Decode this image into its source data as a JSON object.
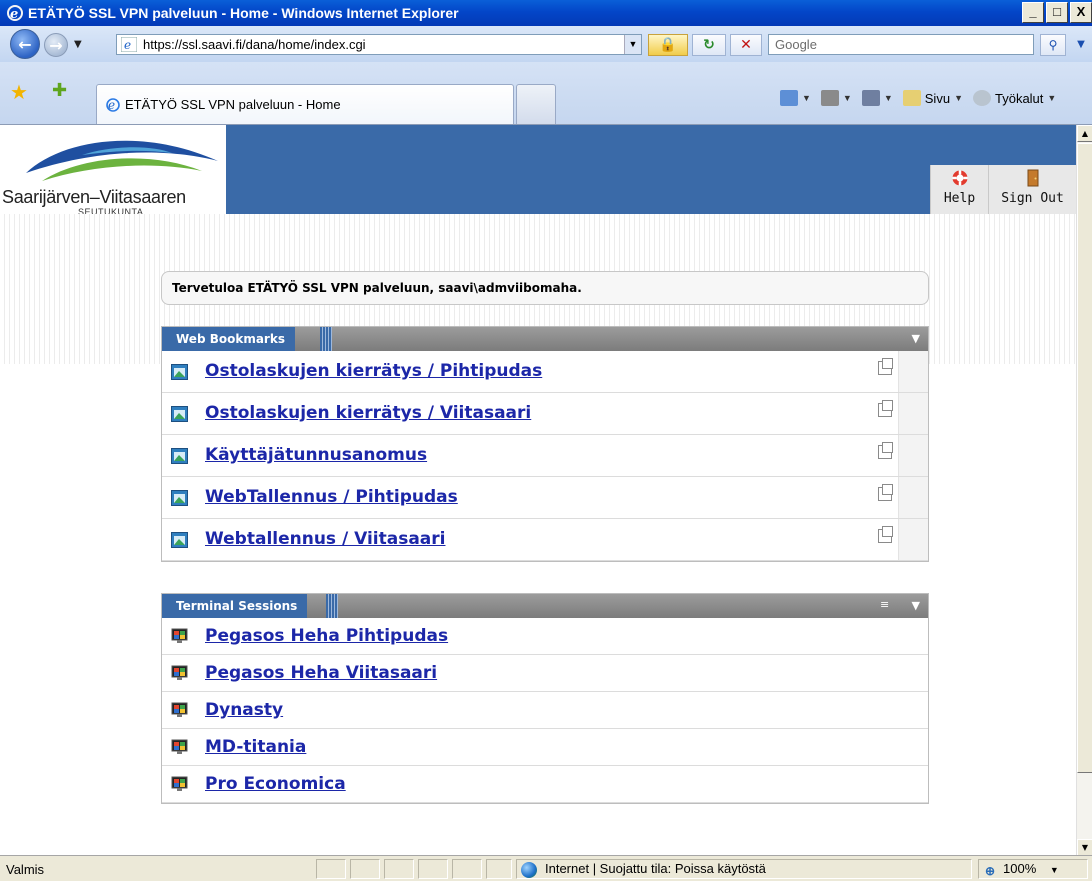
{
  "window": {
    "title": "ETÄTYÖ SSL VPN palveluun - Home - Windows Internet Explorer",
    "min": "_",
    "max": "□",
    "close": "X"
  },
  "address": {
    "url": "https://ssl.saavi.fi/dana/home/index.cgi",
    "search_placeholder": "Google"
  },
  "tabs": {
    "active_label": "ETÄTYÖ SSL VPN palveluun - Home"
  },
  "commands": {
    "page_label": "Sivu",
    "tools_label": "Työkalut"
  },
  "header": {
    "logo_name": "Saarijärven–Viitasaaren",
    "logo_sub": "SEUTUKUNTA",
    "help_label": "Help",
    "signout_label": "Sign Out"
  },
  "welcome": "Tervetuloa ETÄTYÖ SSL VPN palveluun, saavi\\admviibomaha.",
  "web_bookmarks": {
    "title": "Web Bookmarks",
    "items": [
      {
        "label": "Ostolaskujen kierrätys / Pihtipudas"
      },
      {
        "label": "Ostolaskujen kierrätys / Viitasaari"
      },
      {
        "label": "Käyttäjätunnusanomus"
      },
      {
        "label": "WebTallennus / Pihtipudas"
      },
      {
        "label": "Webtallennus / Viitasaari"
      }
    ]
  },
  "terminal_sessions": {
    "title": "Terminal Sessions",
    "items": [
      {
        "label": "Pegasos Heha Pihtipudas"
      },
      {
        "label": "Pegasos Heha Viitasaari"
      },
      {
        "label": "Dynasty"
      },
      {
        "label": "MD-titania"
      },
      {
        "label": "Pro Economica"
      }
    ]
  },
  "status": {
    "text": "Valmis",
    "zone": "Internet | Suojattu tila: Poissa käytöstä",
    "zoom": "100%"
  },
  "colors": {
    "header_blue": "#3a6aa8",
    "link": "#1c27a8"
  }
}
